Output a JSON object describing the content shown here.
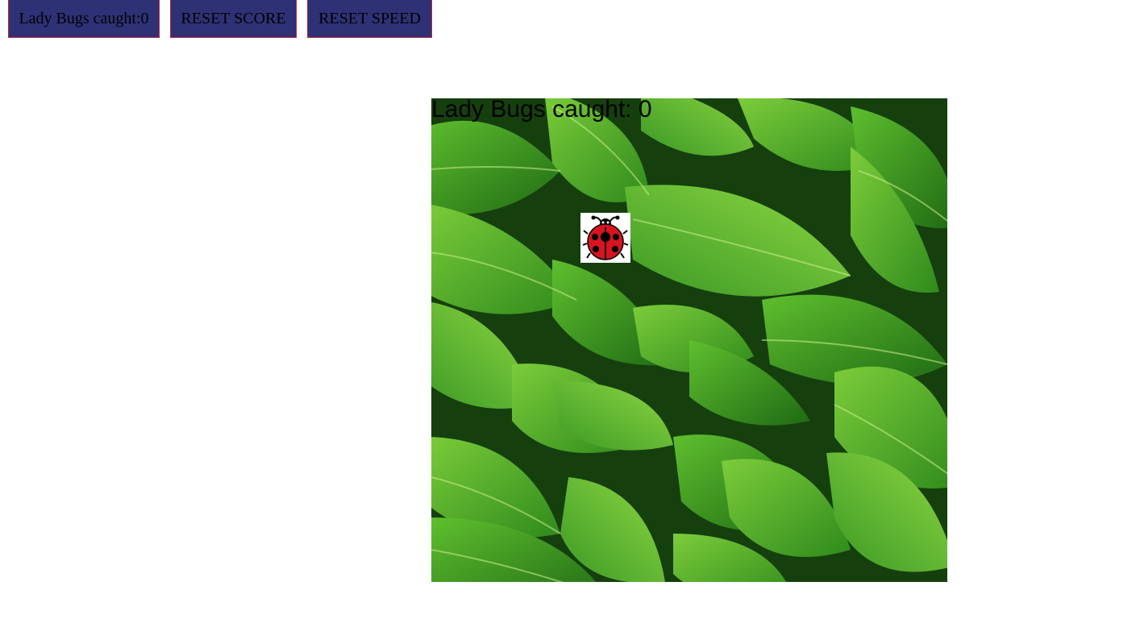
{
  "toolbar": {
    "score_label": "Lady Bugs caught:0",
    "reset_score_label": "RESET SCORE",
    "reset_speed_label": "RESET SPEED"
  },
  "game": {
    "canvas_score_text": "Lady Bugs caught: 0",
    "background": "green-leaves-image",
    "sprite": "ladybug-icon"
  },
  "colors": {
    "button_bg": "#2f3176",
    "button_border": "#b3263a",
    "ladybug_red": "#d8141e",
    "leaf_green": "#3f9a22"
  }
}
